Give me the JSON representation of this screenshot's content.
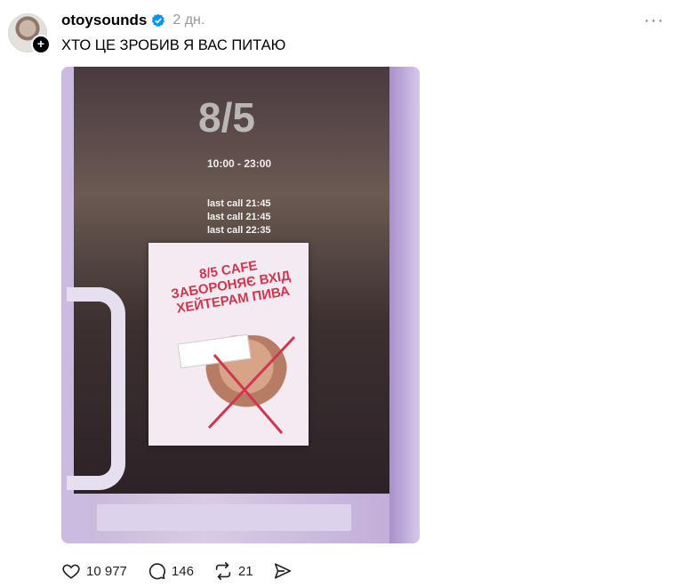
{
  "post": {
    "username": "otoysounds",
    "time": "2 дн.",
    "caption": "ХТО ЦЕ ЗРОБИВ Я ВАС ПИТАЮ",
    "more_label": "···"
  },
  "photo": {
    "door_sign": "8/5",
    "hours": "10:00 - 23:00",
    "call_1": "last call 21:45",
    "call_2": "last call 21:45",
    "call_3": "last call 22:35",
    "poster_text": "8/5 CAFE ЗАБОРОНЯЄ ВХІД ХЕЙТЕРАМ ПИВА"
  },
  "actions": {
    "likes": "10 977",
    "comments": "146",
    "reposts": "21"
  },
  "icons": {
    "verified": "verified-badge-icon",
    "like": "heart-icon",
    "comment": "comment-icon",
    "repost": "repost-icon",
    "share": "send-icon",
    "more": "more-icon"
  },
  "colors": {
    "verified": "#0095f6",
    "poster_red": "#d2354e"
  }
}
